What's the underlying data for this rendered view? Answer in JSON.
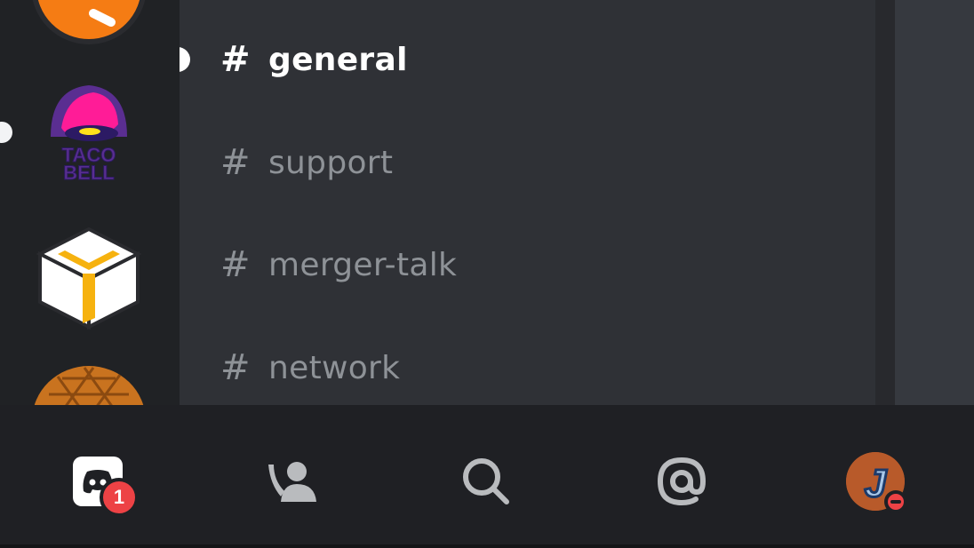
{
  "servers": [
    {
      "name": "orange-server-icon"
    },
    {
      "name": "taco-bell-server-icon",
      "logo_text_1": "TACO",
      "logo_text_2": "BELL"
    },
    {
      "name": "cube-server-icon"
    },
    {
      "name": "acorn-server-icon"
    }
  ],
  "channels": {
    "hash_symbol": "#",
    "items": [
      {
        "label": "general",
        "active": true
      },
      {
        "label": "support",
        "active": false
      },
      {
        "label": "merger-talk",
        "active": false
      },
      {
        "label": "network",
        "active": false
      }
    ]
  },
  "bottom_nav": {
    "home": {
      "icon": "discord-home-icon",
      "badge_count": "1"
    },
    "friends": {
      "icon": "friends-icon"
    },
    "search": {
      "icon": "search-icon"
    },
    "mentions": {
      "icon": "at-mention-icon"
    },
    "profile": {
      "icon": "user-avatar",
      "avatar_letter": "J",
      "status": "do-not-disturb"
    }
  },
  "colors": {
    "rail_bg": "#202225",
    "channels_bg": "#2f3136",
    "nav_bg": "#1f2024",
    "channel_text": "#8e9297",
    "active_text": "#ffffff",
    "badge_red": "#ed4245",
    "accent_orange": "#f57c14"
  }
}
